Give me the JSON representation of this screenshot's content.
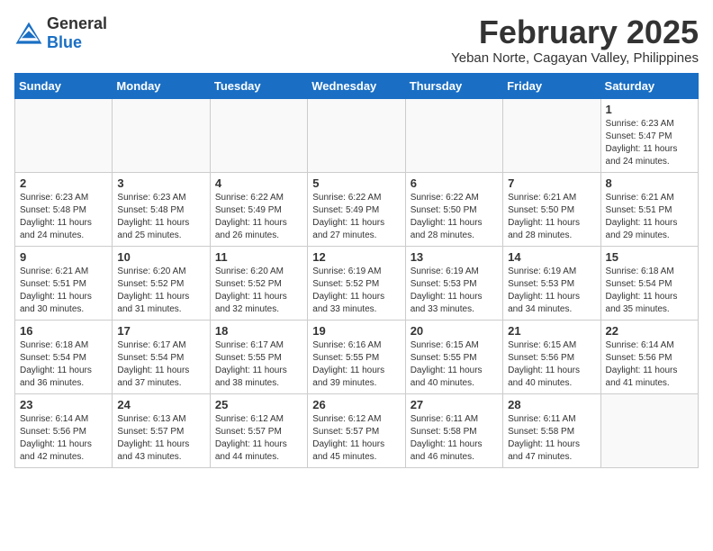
{
  "logo": {
    "general": "General",
    "blue": "Blue"
  },
  "title": "February 2025",
  "subtitle": "Yeban Norte, Cagayan Valley, Philippines",
  "weekdays": [
    "Sunday",
    "Monday",
    "Tuesday",
    "Wednesday",
    "Thursday",
    "Friday",
    "Saturday"
  ],
  "days": [
    {
      "date": "",
      "info": ""
    },
    {
      "date": "",
      "info": ""
    },
    {
      "date": "",
      "info": ""
    },
    {
      "date": "",
      "info": ""
    },
    {
      "date": "",
      "info": ""
    },
    {
      "date": "",
      "info": ""
    },
    {
      "date": "1",
      "info": "Sunrise: 6:23 AM\nSunset: 5:47 PM\nDaylight: 11 hours\nand 24 minutes."
    },
    {
      "date": "2",
      "info": "Sunrise: 6:23 AM\nSunset: 5:48 PM\nDaylight: 11 hours\nand 24 minutes."
    },
    {
      "date": "3",
      "info": "Sunrise: 6:23 AM\nSunset: 5:48 PM\nDaylight: 11 hours\nand 25 minutes."
    },
    {
      "date": "4",
      "info": "Sunrise: 6:22 AM\nSunset: 5:49 PM\nDaylight: 11 hours\nand 26 minutes."
    },
    {
      "date": "5",
      "info": "Sunrise: 6:22 AM\nSunset: 5:49 PM\nDaylight: 11 hours\nand 27 minutes."
    },
    {
      "date": "6",
      "info": "Sunrise: 6:22 AM\nSunset: 5:50 PM\nDaylight: 11 hours\nand 28 minutes."
    },
    {
      "date": "7",
      "info": "Sunrise: 6:21 AM\nSunset: 5:50 PM\nDaylight: 11 hours\nand 28 minutes."
    },
    {
      "date": "8",
      "info": "Sunrise: 6:21 AM\nSunset: 5:51 PM\nDaylight: 11 hours\nand 29 minutes."
    },
    {
      "date": "9",
      "info": "Sunrise: 6:21 AM\nSunset: 5:51 PM\nDaylight: 11 hours\nand 30 minutes."
    },
    {
      "date": "10",
      "info": "Sunrise: 6:20 AM\nSunset: 5:52 PM\nDaylight: 11 hours\nand 31 minutes."
    },
    {
      "date": "11",
      "info": "Sunrise: 6:20 AM\nSunset: 5:52 PM\nDaylight: 11 hours\nand 32 minutes."
    },
    {
      "date": "12",
      "info": "Sunrise: 6:19 AM\nSunset: 5:52 PM\nDaylight: 11 hours\nand 33 minutes."
    },
    {
      "date": "13",
      "info": "Sunrise: 6:19 AM\nSunset: 5:53 PM\nDaylight: 11 hours\nand 33 minutes."
    },
    {
      "date": "14",
      "info": "Sunrise: 6:19 AM\nSunset: 5:53 PM\nDaylight: 11 hours\nand 34 minutes."
    },
    {
      "date": "15",
      "info": "Sunrise: 6:18 AM\nSunset: 5:54 PM\nDaylight: 11 hours\nand 35 minutes."
    },
    {
      "date": "16",
      "info": "Sunrise: 6:18 AM\nSunset: 5:54 PM\nDaylight: 11 hours\nand 36 minutes."
    },
    {
      "date": "17",
      "info": "Sunrise: 6:17 AM\nSunset: 5:54 PM\nDaylight: 11 hours\nand 37 minutes."
    },
    {
      "date": "18",
      "info": "Sunrise: 6:17 AM\nSunset: 5:55 PM\nDaylight: 11 hours\nand 38 minutes."
    },
    {
      "date": "19",
      "info": "Sunrise: 6:16 AM\nSunset: 5:55 PM\nDaylight: 11 hours\nand 39 minutes."
    },
    {
      "date": "20",
      "info": "Sunrise: 6:15 AM\nSunset: 5:55 PM\nDaylight: 11 hours\nand 40 minutes."
    },
    {
      "date": "21",
      "info": "Sunrise: 6:15 AM\nSunset: 5:56 PM\nDaylight: 11 hours\nand 40 minutes."
    },
    {
      "date": "22",
      "info": "Sunrise: 6:14 AM\nSunset: 5:56 PM\nDaylight: 11 hours\nand 41 minutes."
    },
    {
      "date": "23",
      "info": "Sunrise: 6:14 AM\nSunset: 5:56 PM\nDaylight: 11 hours\nand 42 minutes."
    },
    {
      "date": "24",
      "info": "Sunrise: 6:13 AM\nSunset: 5:57 PM\nDaylight: 11 hours\nand 43 minutes."
    },
    {
      "date": "25",
      "info": "Sunrise: 6:12 AM\nSunset: 5:57 PM\nDaylight: 11 hours\nand 44 minutes."
    },
    {
      "date": "26",
      "info": "Sunrise: 6:12 AM\nSunset: 5:57 PM\nDaylight: 11 hours\nand 45 minutes."
    },
    {
      "date": "27",
      "info": "Sunrise: 6:11 AM\nSunset: 5:58 PM\nDaylight: 11 hours\nand 46 minutes."
    },
    {
      "date": "28",
      "info": "Sunrise: 6:11 AM\nSunset: 5:58 PM\nDaylight: 11 hours\nand 47 minutes."
    },
    {
      "date": "",
      "info": ""
    }
  ]
}
